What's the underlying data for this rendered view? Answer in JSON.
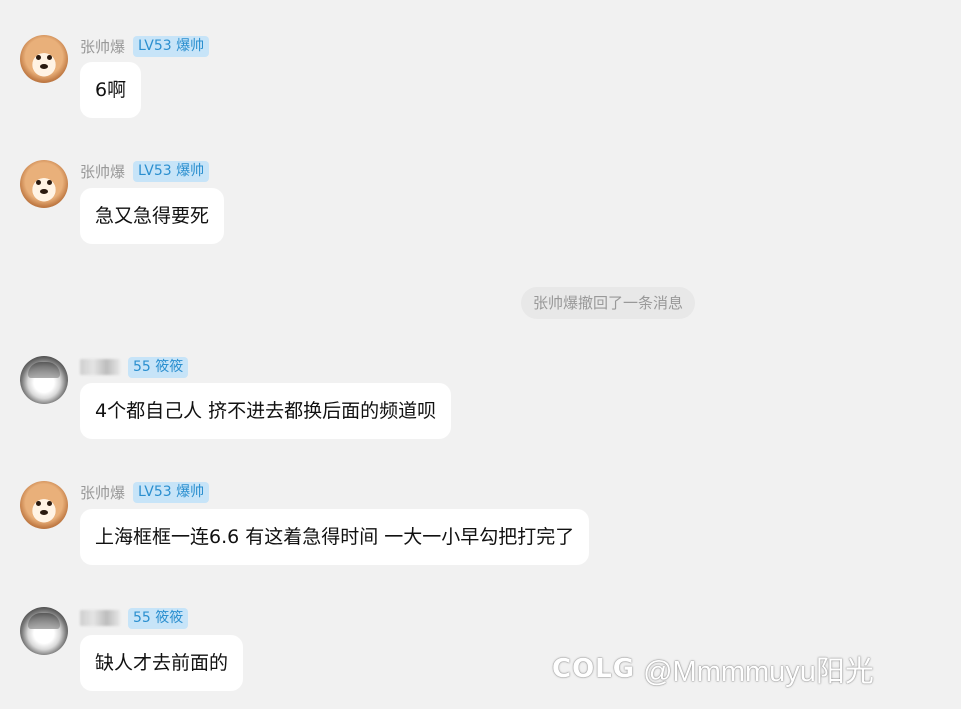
{
  "messages": [
    {
      "nickname": "张帅爆",
      "badge": "LV53 爆帅",
      "text": "6啊",
      "avatar_icon": "shiba-dog-avatar"
    },
    {
      "nickname": "张帅爆",
      "badge": "LV53 爆帅",
      "text": "急又急得要死",
      "avatar_icon": "shiba-dog-avatar"
    },
    {
      "nickname": "",
      "badge": "55 筱筱",
      "text": "4个都自己人 挤不进去都换后面的频道呗",
      "avatar_icon": "anime-girl-avatar"
    },
    {
      "nickname": "张帅爆",
      "badge": "LV53 爆帅",
      "text": "上海框框一连6.6 有这着急得时间 一大一小早勾把打完了",
      "avatar_icon": "shiba-dog-avatar"
    },
    {
      "nickname": "",
      "badge": "55 筱筱",
      "text": "缺人才去前面的",
      "avatar_icon": "anime-girl-avatar"
    }
  ],
  "system_notice": "张帅爆撤回了一条消息",
  "watermark": {
    "logo": "COLG",
    "handle": "@Mmmmuyu阳光"
  },
  "colors": {
    "background": "#f1f1f1",
    "bubble": "#ffffff",
    "badge_bg": "#c7e4f8",
    "badge_text": "#2b8fcf",
    "nickname": "#999999"
  }
}
